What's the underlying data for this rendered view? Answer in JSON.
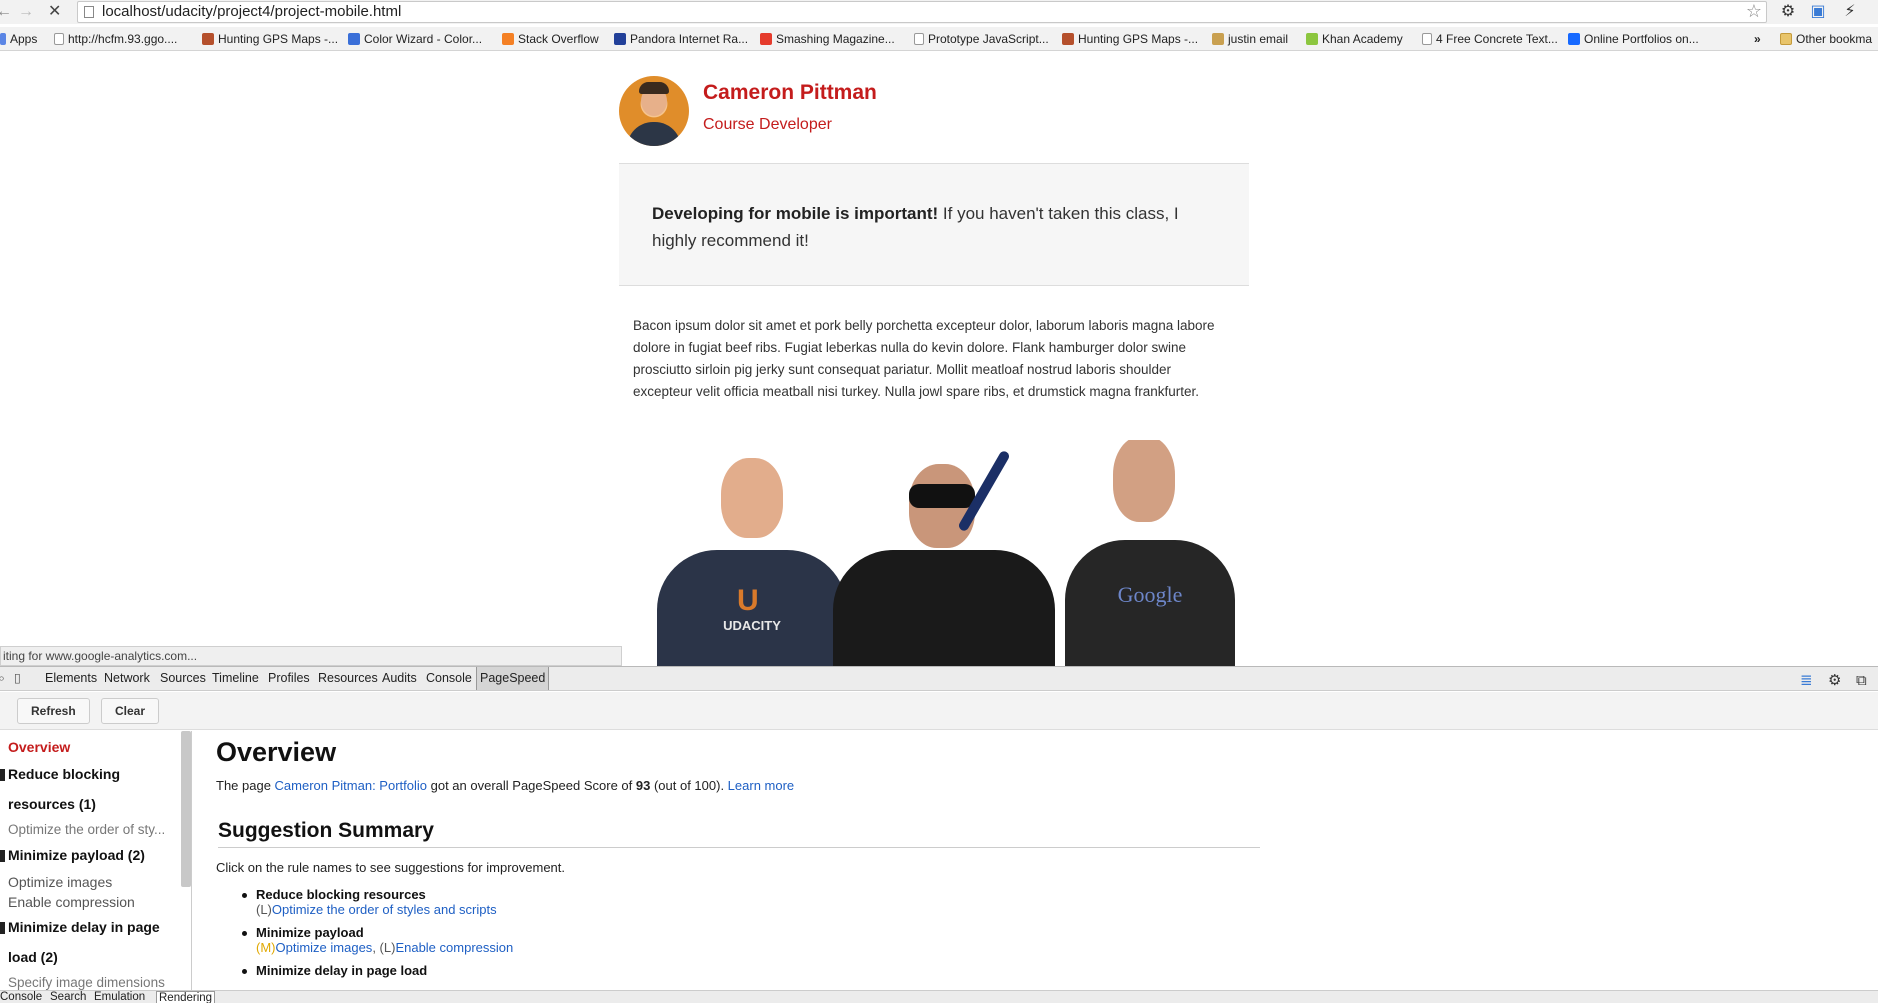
{
  "browser": {
    "back": "←",
    "forward": "→",
    "reload": "✕",
    "url": "localhost/udacity/project4/project-mobile.html",
    "bookmarks": [
      "Apps",
      "http://hcfm.93.ggo....",
      "Hunting GPS Maps -...",
      "Color Wizard - Color...",
      "Stack Overflow",
      "Pandora Internet Ra...",
      "Smashing Magazine...",
      "Prototype JavaScript...",
      "Hunting GPS Maps -...",
      "justin email",
      "Khan Academy",
      "4 Free Concrete Text...",
      "Online Portfolios on...",
      "»",
      "Other bookma"
    ],
    "status": "iting for www.google-analytics.com..."
  },
  "page": {
    "name": "Cameron Pittman",
    "role": "Course Developer",
    "quote_bold": "Developing for mobile is important!",
    "quote_rest": " If you haven't taken this class, I highly recommend it!",
    "bacon": "Bacon ipsum dolor sit amet et pork belly porchetta excepteur dolor, laborum laboris magna labore dolore in fugiat beef ribs. Fugiat leberkas nulla do kevin dolore. Flank hamburger dolor swine prosciutto sirloin pig jerky sunt consequat pariatur. Mollit meatloaf nostrud laboris shoulder excepteur velit officia meatball nisi turkey. Nulla jowl spare ribs, et drumstick magna frankfurter.",
    "photo_shirt_left": "UDACITY",
    "photo_shirt_right": "Google"
  },
  "devtools": {
    "tabs": [
      "Elements",
      "Network",
      "Sources",
      "Timeline",
      "Profiles",
      "Resources",
      "Audits",
      "Console",
      "PageSpeed"
    ],
    "active_tab": "PageSpeed",
    "buttons": {
      "refresh": "Refresh",
      "clear": "Clear"
    },
    "sidebar": {
      "overview": "Overview",
      "g1_line1": "Reduce blocking",
      "g1_line2": "resources (1)",
      "g1_item1": "Optimize the order of sty...",
      "g2_title": "Minimize payload (2)",
      "g2_item1": "Optimize images",
      "g2_item2": "Enable compression",
      "g3_line1": "Minimize delay in page",
      "g3_line2": "load (2)",
      "g3_item1": "Specify image dimensions"
    },
    "main": {
      "title": "Overview",
      "ov_pre": "The page ",
      "ov_link": "Cameron Pitman: Portfolio",
      "ov_mid": " got an overall PageSpeed Score of ",
      "ov_score": "93",
      "ov_post": " (out of 100). ",
      "ov_learn": "Learn more",
      "summary_title": "Suggestion Summary",
      "summary_intro": "Click on the rule names to see suggestions for improvement.",
      "rule1_title": "Reduce blocking resources",
      "rule1_prio": "(L)",
      "rule1_link": "Optimize the order of styles and scripts",
      "rule2_title": "Minimize payload",
      "rule2_prio1": "(M)",
      "rule2_link1": "Optimize images",
      "rule2_sep": ", ",
      "rule2_prio2": "(L)",
      "rule2_link2": "Enable compression",
      "rule3_title": "Minimize delay in page load"
    },
    "drawer_tabs": [
      "Console",
      "Search",
      "Emulation",
      "Rendering"
    ],
    "drawer_active": "Rendering"
  },
  "colors": {
    "accent": "#c41c1c",
    "link": "#1e5fc4",
    "priority_medium": "#e0a800"
  }
}
